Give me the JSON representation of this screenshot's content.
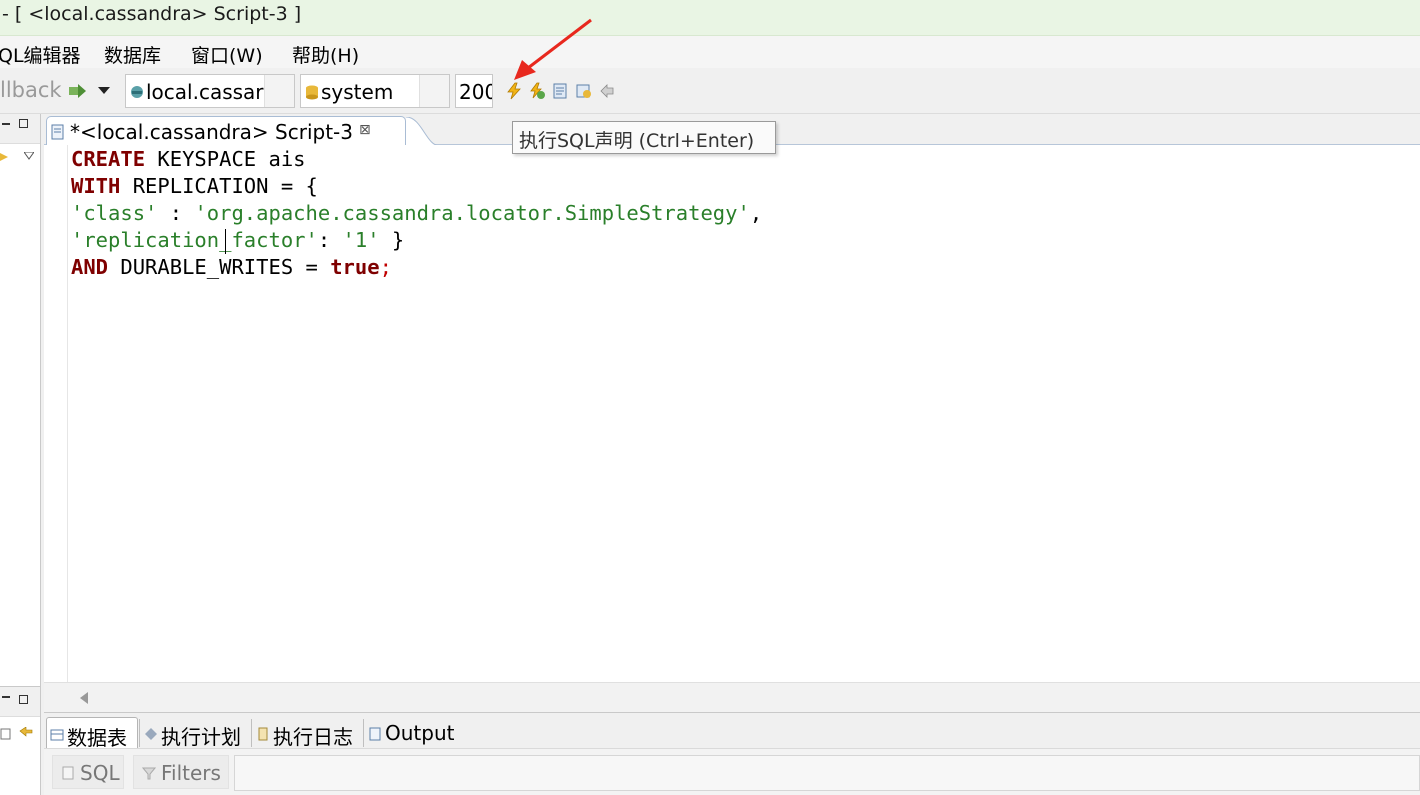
{
  "window": {
    "title": "- [ <local.cassandra> Script-3 ]"
  },
  "menu": {
    "items": [
      "QL编辑器",
      "数据库",
      "窗口(W)",
      "帮助(H)"
    ]
  },
  "toolbar": {
    "rollback_label": "llback",
    "connection": "local.cassar",
    "schema": "system",
    "limit": "200",
    "execute_tooltip": "执行SQL声明 (Ctrl+Enter)"
  },
  "editor": {
    "tab_label": "*<local.cassandra> Script-3",
    "close_glyph": "⊠"
  },
  "code": {
    "line1": {
      "kw": "CREATE",
      "rest": " KEYSPACE ais"
    },
    "line2": {
      "kw": "WITH",
      "rest": " REPLICATION = {"
    },
    "line3": {
      "s1": "'class'",
      "mid": " : ",
      "s2": "'org.apache.cassandra.locator.SimpleStrategy'",
      "end": ","
    },
    "line4": {
      "s1": "'replication_factor'",
      "mid": ": ",
      "s2": "'1'",
      "end": " }"
    },
    "line5": {
      "kw1": "AND",
      "mid": " DURABLE_WRITES = ",
      "kw2": "true",
      "semi": ";"
    }
  },
  "results": {
    "tabs": [
      "数据表",
      "执行计划",
      "执行日志",
      "Output"
    ],
    "sql_button": "SQL",
    "filters_button": "Filters"
  },
  "colors": {
    "keyword": "#7f0000",
    "string": "#2a7f2a",
    "annotation_arrow": "#e8281e",
    "title_bg": "#e9f5e4"
  }
}
